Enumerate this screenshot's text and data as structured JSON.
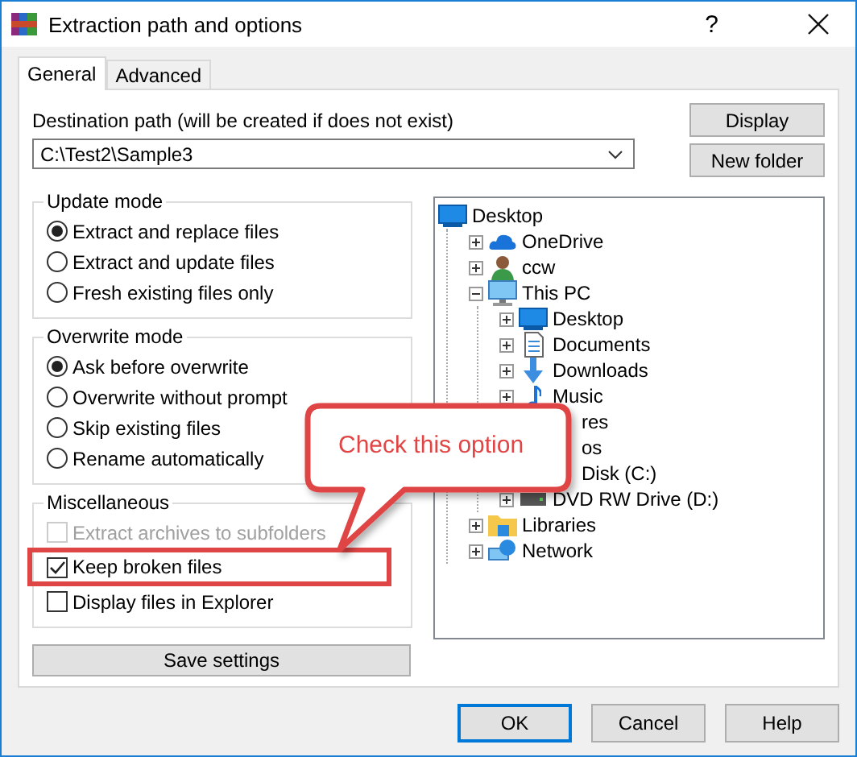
{
  "window": {
    "title": "Extraction path and options",
    "help_glyph": "?"
  },
  "tabs": [
    {
      "label": "General",
      "selected": true
    },
    {
      "label": "Advanced",
      "selected": false
    }
  ],
  "destination": {
    "label": "Destination path (will be created if does not exist)",
    "value": "C:\\Test2\\Sample3"
  },
  "side_buttons": [
    "Display",
    "New folder"
  ],
  "groups": [
    {
      "title": "Update mode",
      "kind": "radio",
      "options": [
        {
          "label": "Extract and replace files",
          "selected": true
        },
        {
          "label": "Extract and update files",
          "selected": false
        },
        {
          "label": "Fresh existing files only",
          "selected": false
        }
      ]
    },
    {
      "title": "Overwrite mode",
      "kind": "radio",
      "options": [
        {
          "label": "Ask before overwrite",
          "selected": true
        },
        {
          "label": "Overwrite without prompt",
          "selected": false
        },
        {
          "label": "Skip existing files",
          "selected": false
        },
        {
          "label": "Rename automatically",
          "selected": false
        }
      ]
    },
    {
      "title": "Miscellaneous",
      "kind": "check",
      "options": [
        {
          "label": "Extract archives to subfolders",
          "checked": false,
          "disabled": true,
          "highlighted": false
        },
        {
          "label": "Keep broken files",
          "checked": true,
          "disabled": false,
          "highlighted": true
        },
        {
          "label": "Display files in Explorer",
          "checked": false,
          "disabled": false,
          "highlighted": false
        }
      ]
    }
  ],
  "save_button": "Save settings",
  "tree": [
    {
      "label": "Desktop",
      "kind": "desktop",
      "children": [
        {
          "label": "OneDrive",
          "kind": "cloud",
          "expanded": false
        },
        {
          "label": "ccw",
          "kind": "user",
          "expanded": false
        },
        {
          "label": "This PC",
          "kind": "computer",
          "expanded": true,
          "children": [
            {
              "label": "Desktop",
              "kind": "desktop",
              "expanded": false
            },
            {
              "label": "Documents",
              "kind": "documents",
              "expanded": false
            },
            {
              "label": "Downloads",
              "kind": "download",
              "expanded": false
            },
            {
              "label": "Music",
              "kind": "music",
              "expanded": false
            },
            {
              "label": "res",
              "kind": "covered"
            },
            {
              "label": "os",
              "kind": "covered"
            },
            {
              "label": "Disk (C:)",
              "kind": "covered"
            },
            {
              "label": "DVD RW Drive (D:)",
              "kind": "drive",
              "expanded": false
            }
          ]
        },
        {
          "label": "Libraries",
          "kind": "libraries",
          "expanded": false
        },
        {
          "label": "Network",
          "kind": "network",
          "expanded": false
        }
      ]
    }
  ],
  "callout": {
    "text": "Check this option"
  },
  "footer_buttons": [
    {
      "label": "OK",
      "default": true
    },
    {
      "label": "Cancel",
      "default": false
    },
    {
      "label": "Help",
      "default": false
    }
  ]
}
